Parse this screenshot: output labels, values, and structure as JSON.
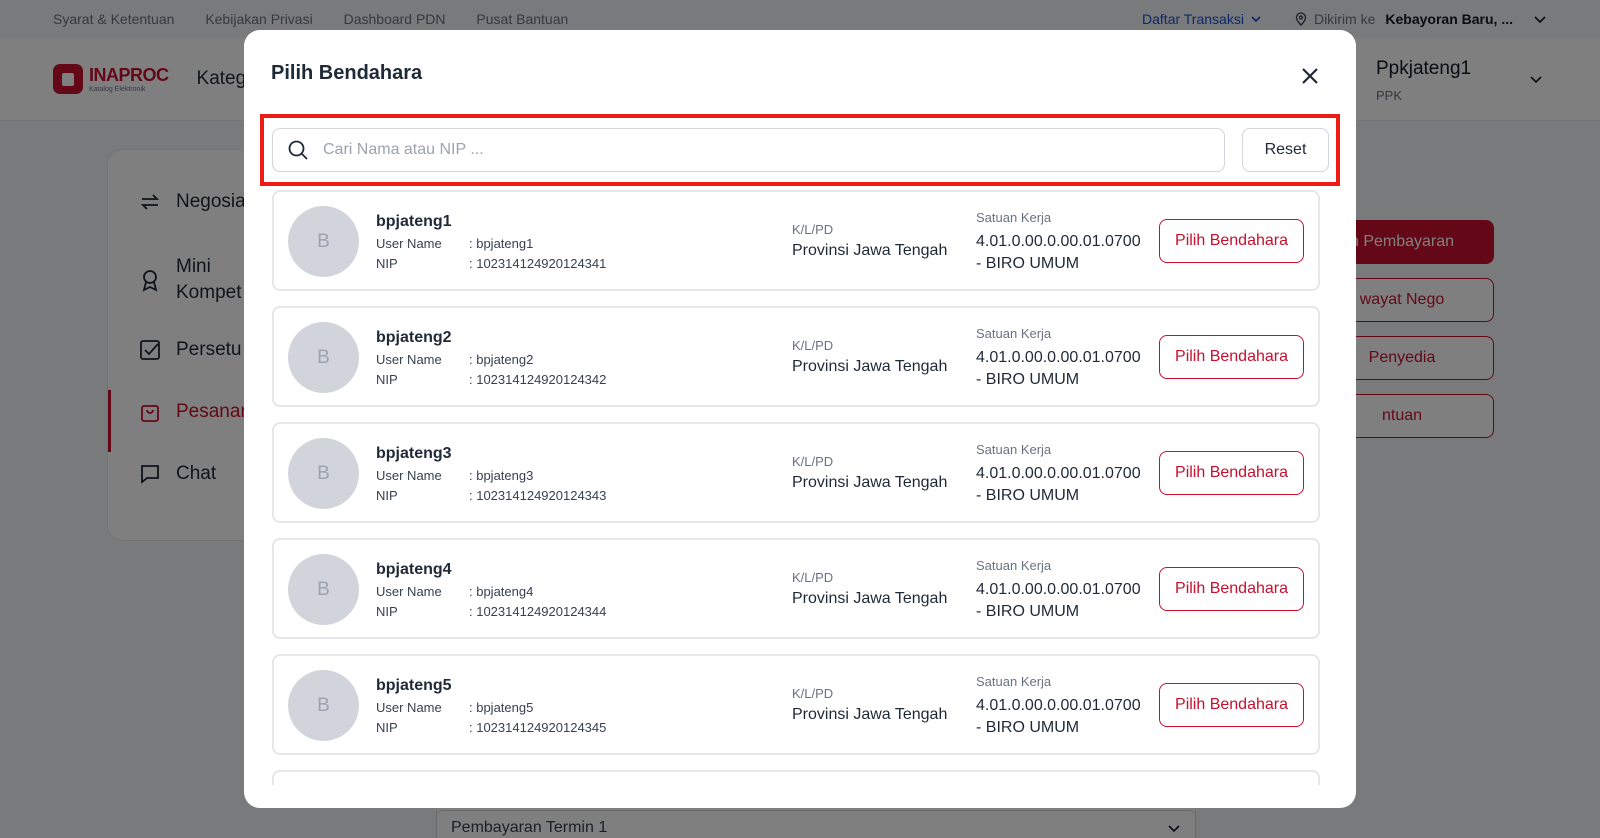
{
  "topbar": {
    "links": [
      "Syarat & Ketentuan",
      "Kebijakan Privasi",
      "Dashboard PDN",
      "Pusat Bantuan"
    ],
    "daftar_transaksi": "Daftar Transaksi",
    "dikirim_label": "Dikirim ke",
    "dikirim_value": "Kebayoran Baru, ..."
  },
  "header": {
    "logo_title": "INAPROC",
    "logo_subtitle": "Katalog Elektronik",
    "kategori": "Kateg",
    "user_name": "Ppkjateng1",
    "user_role": "PPK"
  },
  "sidebar": {
    "items": [
      {
        "label": "Negosia"
      },
      {
        "label": "Mini Kompet"
      },
      {
        "label": "Persetu"
      },
      {
        "label": "Pesanan"
      },
      {
        "label": "Chat"
      }
    ]
  },
  "right_actions": [
    "n Pembayaran",
    "wayat Nego",
    "Penyedia",
    "ntuan"
  ],
  "bottom_select": "Pembayaran Termin 1",
  "modal": {
    "title": "Pilih Bendahara",
    "search_placeholder": "Cari Nama atau NIP ...",
    "reset_label": "Reset",
    "labels": {
      "user_name": "User Name",
      "nip": "NIP",
      "klpd": "K/L/PD",
      "satuan_kerja": "Satuan Kerja",
      "pick_button": "Pilih Bendahara"
    },
    "items": [
      {
        "initial": "B",
        "name": "bpjateng1",
        "user_name": ": bpjateng1",
        "nip": ": 102314124920124341",
        "klpd": "Provinsi Jawa Tengah",
        "satuan_kerja": "4.01.0.00.0.00.01.0700 - BIRO UMUM"
      },
      {
        "initial": "B",
        "name": "bpjateng2",
        "user_name": ": bpjateng2",
        "nip": ": 102314124920124342",
        "klpd": "Provinsi Jawa Tengah",
        "satuan_kerja": "4.01.0.00.0.00.01.0700 - BIRO UMUM"
      },
      {
        "initial": "B",
        "name": "bpjateng3",
        "user_name": ": bpjateng3",
        "nip": ": 102314124920124343",
        "klpd": "Provinsi Jawa Tengah",
        "satuan_kerja": "4.01.0.00.0.00.01.0700 - BIRO UMUM"
      },
      {
        "initial": "B",
        "name": "bpjateng4",
        "user_name": ": bpjateng4",
        "nip": ": 102314124920124344",
        "klpd": "Provinsi Jawa Tengah",
        "satuan_kerja": "4.01.0.00.0.00.01.0700 - BIRO UMUM"
      },
      {
        "initial": "B",
        "name": "bpjateng5",
        "user_name": ": bpjateng5",
        "nip": ": 102314124920124345",
        "klpd": "Provinsi Jawa Tengah",
        "satuan_kerja": "4.01.0.00.0.00.01.0700 - BIRO UMUM"
      }
    ]
  },
  "colors": {
    "brand": "#c8102e",
    "highlight": "#ee1c15"
  }
}
